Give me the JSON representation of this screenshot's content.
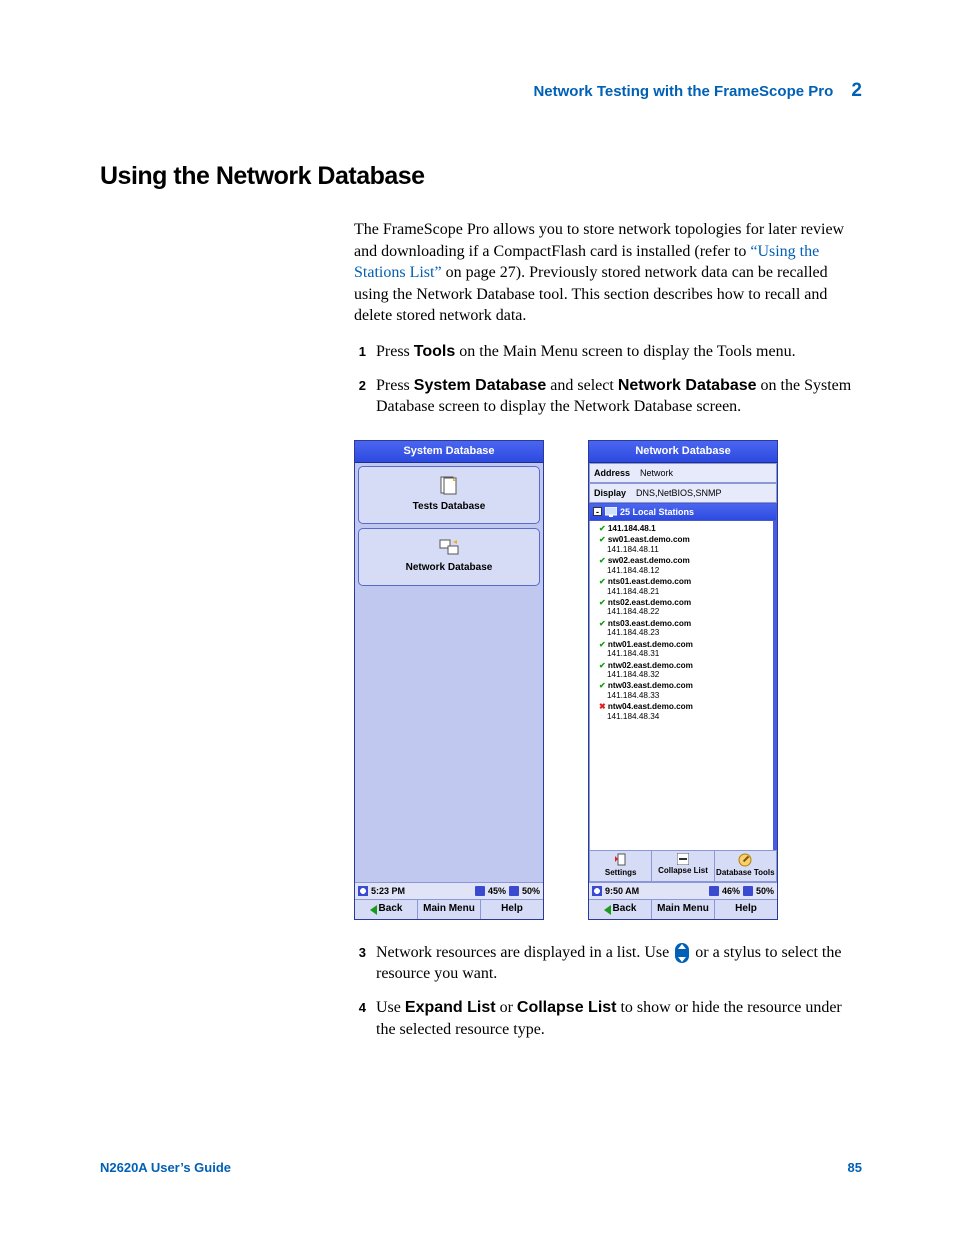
{
  "header": {
    "title": "Network Testing with the FrameScope Pro",
    "chapter": "2"
  },
  "section_title": "Using the Network Database",
  "intro_before_link": "The FrameScope Pro allows you to store network topologies for later review and downloading if a CompactFlash card is installed (refer to ",
  "intro_link": "“Using the Stations List”",
  "intro_after_link": " on page 27). Previously stored network data can be recalled using the Network Database tool. This section describes how to recall and delete stored network data.",
  "steps": {
    "s1": {
      "num": "1",
      "a": "Press ",
      "b": "Tools",
      "c": " on the Main Menu screen to display the Tools menu."
    },
    "s2": {
      "num": "2",
      "a": "Press ",
      "b": "System Database",
      "c": " and select ",
      "d": "Network Database",
      "e": " on the System Database screen to display the Network Database screen."
    },
    "s3": {
      "num": "3",
      "a": "Network resources are displayed in a list. Use ",
      "b": " or a stylus to select the resource you want."
    },
    "s4": {
      "num": "4",
      "a": "Use ",
      "b": "Expand List",
      "c": " or ",
      "d": "Collapse List",
      "e": " to show or hide the resource under the selected resource type."
    }
  },
  "screen_left": {
    "title": "System Database",
    "btn1": "Tests Database",
    "btn2": "Network Database",
    "time": "5:23 PM",
    "bat": "45%",
    "disk": "50%",
    "back": "Back",
    "menu": "Main Menu",
    "help": "Help"
  },
  "screen_right": {
    "title": "Network Database",
    "row1_label": "Address",
    "row1_val": "Network",
    "row2_label": "Display",
    "row2_val": "DNS,NetBIOS,SNMP",
    "tree_header": "25 Local Stations",
    "stations": [
      {
        "host": "141.184.48.1",
        "ip": "",
        "ok": true
      },
      {
        "host": "sw01.east.demo.com",
        "ip": "141.184.48.11",
        "ok": true
      },
      {
        "host": "sw02.east.demo.com",
        "ip": "141.184.48.12",
        "ok": true
      },
      {
        "host": "nts01.east.demo.com",
        "ip": "141.184.48.21",
        "ok": true
      },
      {
        "host": "nts02.east.demo.com",
        "ip": "141.184.48.22",
        "ok": true
      },
      {
        "host": "nts03.east.demo.com",
        "ip": "141.184.48.23",
        "ok": true
      },
      {
        "host": "ntw01.east.demo.com",
        "ip": "141.184.48.31",
        "ok": true
      },
      {
        "host": "ntw02.east.demo.com",
        "ip": "141.184.48.32",
        "ok": true
      },
      {
        "host": "ntw03.east.demo.com",
        "ip": "141.184.48.33",
        "ok": true
      },
      {
        "host": "ntw04.east.demo.com",
        "ip": "141.184.48.34",
        "ok": false
      }
    ],
    "tool1": "Settings",
    "tool2": "Collapse List",
    "tool3": "Database Tools",
    "time": "9:50 AM",
    "bat": "46%",
    "disk": "50%",
    "back": "Back",
    "menu": "Main Menu",
    "help": "Help"
  },
  "footer": {
    "left": "N2620A User’s Guide",
    "right": "85"
  }
}
